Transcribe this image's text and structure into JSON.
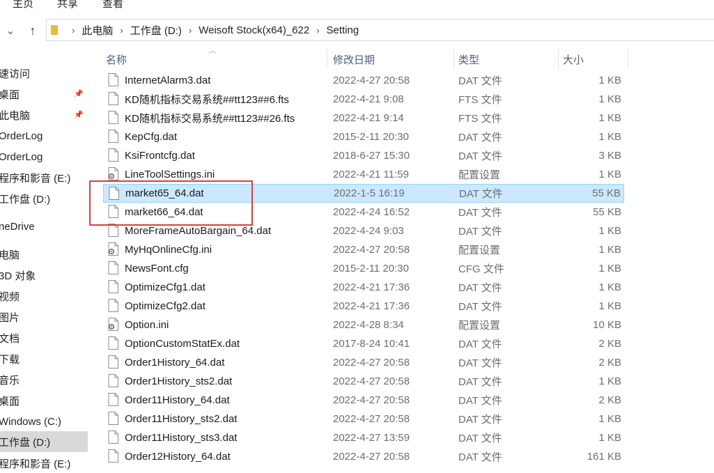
{
  "ribbon": {
    "tabs": [
      "主页",
      "共享",
      "查看"
    ]
  },
  "address": {
    "crumbs": [
      "此电脑",
      "工作盘 (D:)",
      "Weisoft Stock(x64)_622",
      "Setting"
    ]
  },
  "navpane": {
    "items": [
      {
        "label": "速访问"
      },
      {
        "label": "桌面"
      },
      {
        "label": "此电脑"
      },
      {
        "label": "OrderLog"
      },
      {
        "label": "OrderLog"
      },
      {
        "label": "程序和影音 (E:)"
      },
      {
        "label": "工作盘 (D:)"
      },
      {
        "label": "neDrive"
      },
      {
        "label": "电脑"
      },
      {
        "label": "3D 对象"
      },
      {
        "label": "视频"
      },
      {
        "label": "图片"
      },
      {
        "label": "文档"
      },
      {
        "label": "下载"
      },
      {
        "label": "音乐"
      },
      {
        "label": "桌面"
      },
      {
        "label": "Windows (C:)"
      },
      {
        "label": "工作盘 (D:)"
      },
      {
        "label": "程序和影音 (E:)"
      }
    ]
  },
  "columns": {
    "name": "名称",
    "date": "修改日期",
    "type": "类型",
    "size": "大小"
  },
  "files": [
    {
      "name": "InternetAlarm3.dat",
      "date": "2022-4-27 20:58",
      "type": "DAT 文件",
      "size": "1 KB",
      "icon": "file-icon"
    },
    {
      "name": "KD随机指标交易系统##tt123##6.fts",
      "date": "2022-4-21 9:08",
      "type": "FTS 文件",
      "size": "1 KB",
      "icon": "file-icon"
    },
    {
      "name": "KD随机指标交易系统##tt123##26.fts",
      "date": "2022-4-21 9:14",
      "type": "FTS 文件",
      "size": "1 KB",
      "icon": "file-icon"
    },
    {
      "name": "KepCfg.dat",
      "date": "2015-2-11 20:30",
      "type": "DAT 文件",
      "size": "1 KB",
      "icon": "file-icon"
    },
    {
      "name": "KsiFrontcfg.dat",
      "date": "2018-6-27 15:30",
      "type": "DAT 文件",
      "size": "3 KB",
      "icon": "file-icon"
    },
    {
      "name": "LineToolSettings.ini",
      "date": "2022-4-21 11:59",
      "type": "配置设置",
      "size": "1 KB",
      "icon": "settings-file-icon"
    },
    {
      "name": "market65_64.dat",
      "date": "2022-1-5 16:19",
      "type": "DAT 文件",
      "size": "55 KB",
      "icon": "file-icon",
      "selected": true
    },
    {
      "name": "market66_64.dat",
      "date": "2022-4-24 16:52",
      "type": "DAT 文件",
      "size": "55 KB",
      "icon": "file-icon"
    },
    {
      "name": "MoreFrameAutoBargain_64.dat",
      "date": "2022-4-24 9:03",
      "type": "DAT 文件",
      "size": "1 KB",
      "icon": "file-icon"
    },
    {
      "name": "MyHqOnlineCfg.ini",
      "date": "2022-4-27 20:58",
      "type": "配置设置",
      "size": "1 KB",
      "icon": "settings-file-icon"
    },
    {
      "name": "NewsFont.cfg",
      "date": "2015-2-11 20:30",
      "type": "CFG 文件",
      "size": "1 KB",
      "icon": "file-icon"
    },
    {
      "name": "OptimizeCfg1.dat",
      "date": "2022-4-21 17:36",
      "type": "DAT 文件",
      "size": "1 KB",
      "icon": "file-icon"
    },
    {
      "name": "OptimizeCfg2.dat",
      "date": "2022-4-21 17:36",
      "type": "DAT 文件",
      "size": "1 KB",
      "icon": "file-icon"
    },
    {
      "name": "Option.ini",
      "date": "2022-4-28 8:34",
      "type": "配置设置",
      "size": "10 KB",
      "icon": "settings-file-icon"
    },
    {
      "name": "OptionCustomStatEx.dat",
      "date": "2017-8-24 10:41",
      "type": "DAT 文件",
      "size": "2 KB",
      "icon": "file-icon"
    },
    {
      "name": "Order1History_64.dat",
      "date": "2022-4-27 20:58",
      "type": "DAT 文件",
      "size": "2 KB",
      "icon": "file-icon"
    },
    {
      "name": "Order1History_sts2.dat",
      "date": "2022-4-27 20:58",
      "type": "DAT 文件",
      "size": "1 KB",
      "icon": "file-icon"
    },
    {
      "name": "Order11History_64.dat",
      "date": "2022-4-27 20:58",
      "type": "DAT 文件",
      "size": "2 KB",
      "icon": "file-icon"
    },
    {
      "name": "Order11History_sts2.dat",
      "date": "2022-4-27 20:58",
      "type": "DAT 文件",
      "size": "1 KB",
      "icon": "file-icon"
    },
    {
      "name": "Order11History_sts3.dat",
      "date": "2022-4-27 13:59",
      "type": "DAT 文件",
      "size": "1 KB",
      "icon": "file-icon"
    },
    {
      "name": "Order12History_64.dat",
      "date": "2022-4-27 20:58",
      "type": "DAT 文件",
      "size": "161 KB",
      "icon": "file-icon"
    }
  ],
  "colors": {
    "selection_bg": "#cce8ff",
    "selection_border": "#99d1ff",
    "annotation": "#e23a3a",
    "header_text": "#4c607a"
  }
}
